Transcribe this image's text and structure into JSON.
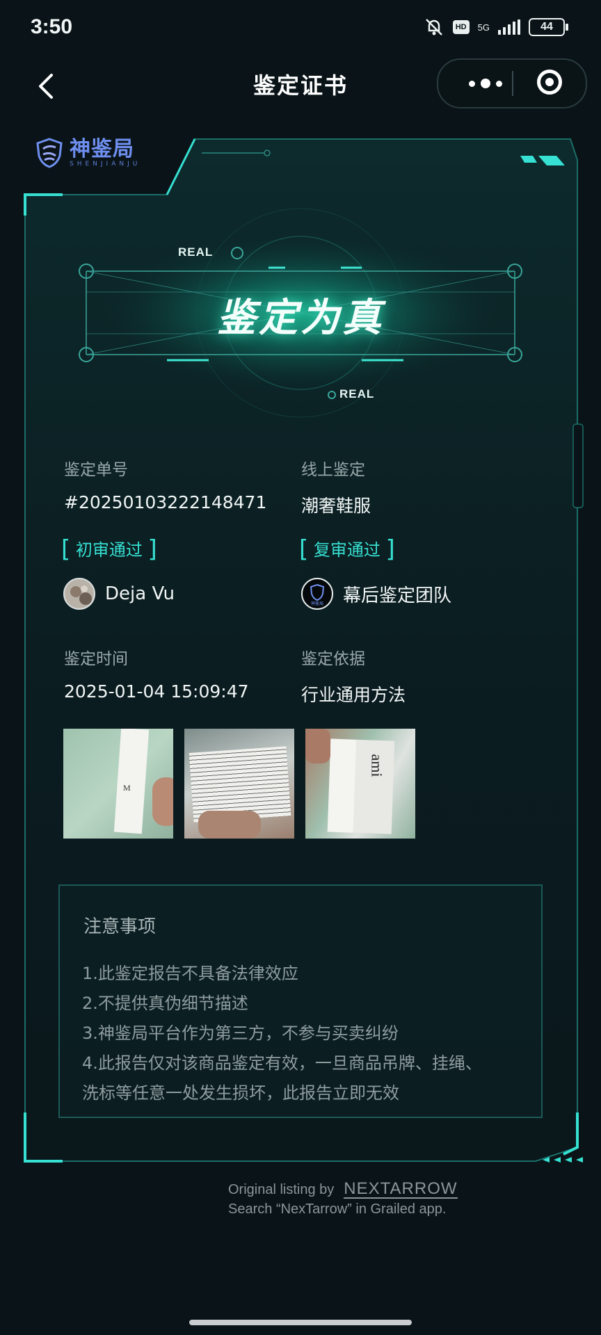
{
  "status_bar": {
    "time": "3:50",
    "network": "5G",
    "hd": "HD",
    "battery": "44"
  },
  "nav": {
    "title": "鉴定证书"
  },
  "brand": {
    "name_cn": "神鉴局",
    "name_en": "SHENJIANJU"
  },
  "certificate": {
    "real_tag_top": "REAL",
    "real_tag_bottom": "REAL",
    "verdict": "鉴定为真",
    "order_label": "鉴定单号",
    "order_value": "#20250103222148471",
    "type_label": "线上鉴定",
    "type_value": "潮奢鞋服",
    "first_review": {
      "badge": "初审通过",
      "name": "Deja Vu"
    },
    "second_review": {
      "badge": "复审通过",
      "name": "幕后鉴定团队",
      "avatar_text": "神鉴局"
    },
    "time_label": "鉴定时间",
    "time_value": "2025-01-04 15:09:47",
    "basis_label": "鉴定依据",
    "basis_value": "行业通用方法",
    "photos": [
      {
        "name": "photo-size-tag",
        "text": "M"
      },
      {
        "name": "photo-care-label",
        "text": ""
      },
      {
        "name": "photo-brand-label",
        "text": "ami"
      }
    ]
  },
  "notes": {
    "title": "注意事项",
    "lines": [
      "1.此鉴定报告不具备法律效应",
      "2.不提供真伪细节描述",
      "3.神鉴局平台作为第三方，不参与买卖纠纷",
      "4.此报告仅对该商品鉴定有效，一旦商品吊牌、挂绳、",
      "洗标等任意一处发生损坏，此报告立即无效"
    ]
  },
  "footer": {
    "listing_prefix": "Original listing by",
    "brand": "NEXTARROW",
    "search_hint": "Search “NexTarrow” in Grailed app."
  },
  "colors": {
    "accent": "#36e0d2",
    "background": "#0a1418",
    "glow": "#1fd3a8",
    "logo": "#6f8ff0"
  }
}
